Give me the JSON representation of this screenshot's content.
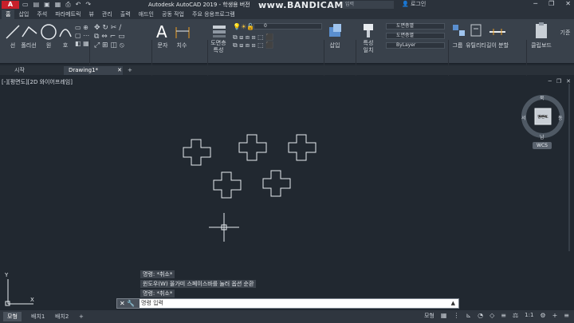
{
  "titlebar": {
    "logo": "A",
    "app_title": "Autodesk AutoCAD 2019 - 학생용 버전",
    "watermark": "www.BANDICAM.com",
    "search_placeholder": "입력",
    "login": "로그인"
  },
  "menu_tabs": [
    {
      "label": "홈"
    },
    {
      "label": "삽입"
    },
    {
      "label": "주석"
    },
    {
      "label": "파라메트릭"
    },
    {
      "label": "뷰"
    },
    {
      "label": "관리"
    },
    {
      "label": "출력"
    },
    {
      "label": "애드인"
    },
    {
      "label": "공동 작업"
    },
    {
      "label": "주요 응용프로그램"
    }
  ],
  "ribbon": {
    "line": "선",
    "polyline": "폴리선",
    "circle": "원",
    "arc": "호",
    "text": "문자",
    "dimension": "치수",
    "layer_props": "도면층\n특성",
    "layer_value": "0",
    "insert": "삽입",
    "match_props": "특성\n일치",
    "prop1": "도면층별",
    "prop2": "도면층별",
    "prop3": "ByLayer",
    "group": "그룹",
    "utilities": "유틸리티",
    "measure": "길이 분할",
    "clipboard": "클립보드",
    "base": "기준"
  },
  "doc_tabs": {
    "start": "시작",
    "drawing": "Drawing1*",
    "add": "+"
  },
  "viewport": {
    "label": "[-][평면도][2D 와이어프레임]"
  },
  "viewcube": {
    "top": "북",
    "east": "동",
    "west": "서",
    "south": "남",
    "face": "평면도",
    "wcs": "WCS"
  },
  "command_history": [
    "명령: *취소*",
    "윈도우(W) 올가미  스페이스바를 눌러 옵션 순환",
    "명령: *취소*"
  ],
  "command_prompt": "명령 입력",
  "layout_tabs": [
    {
      "label": "모형"
    },
    {
      "label": "배치1"
    },
    {
      "label": "배치2"
    }
  ],
  "status": {
    "model": "모형",
    "scale": "1:1"
  }
}
